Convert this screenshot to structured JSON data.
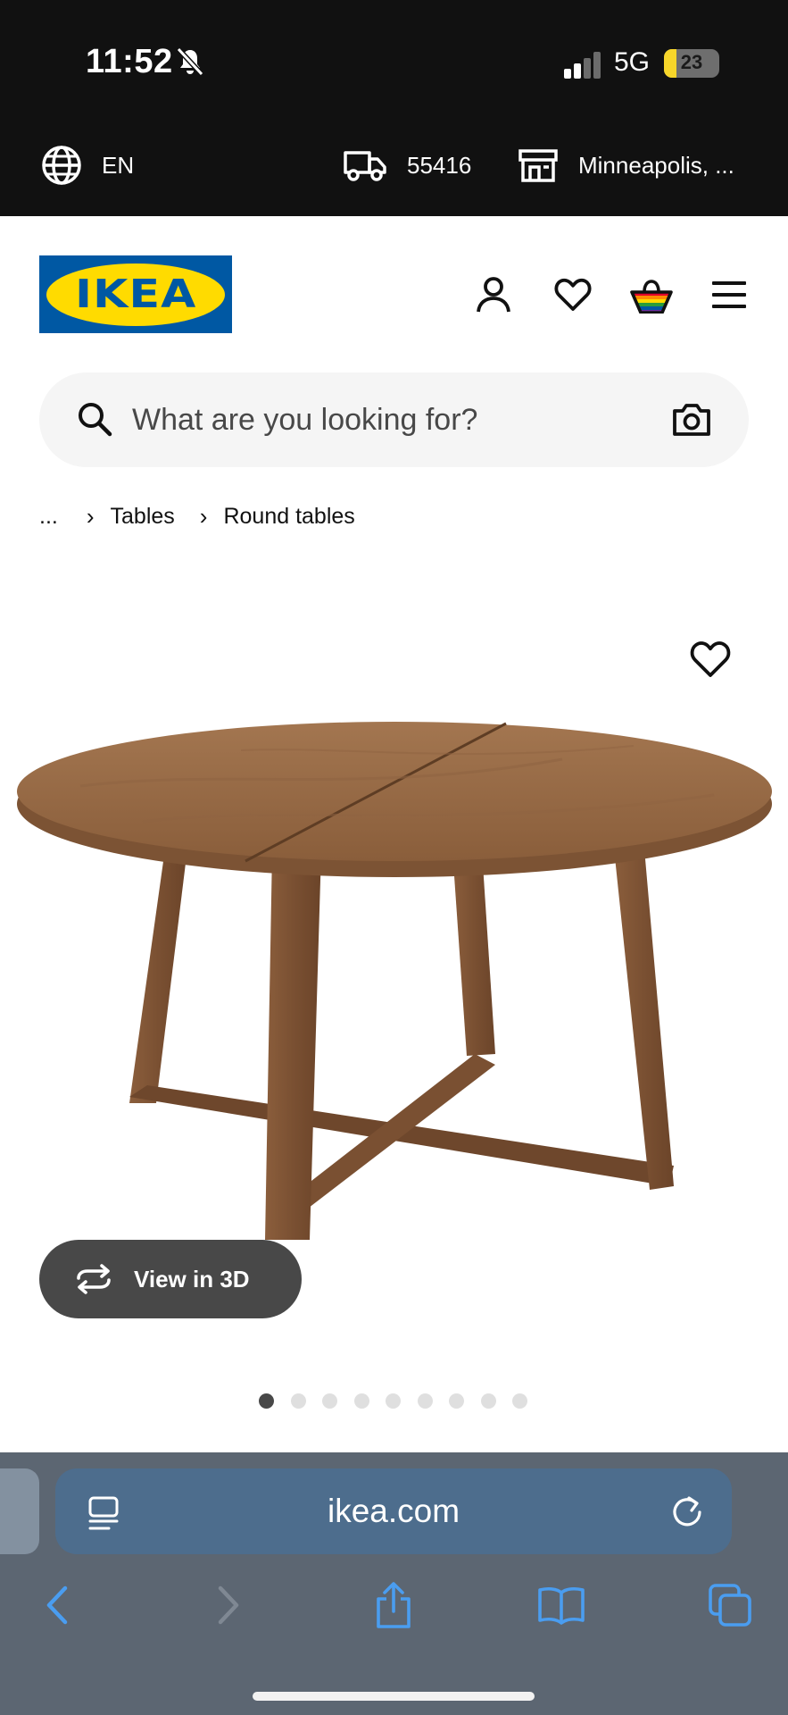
{
  "status_bar": {
    "time": "11:52",
    "network": "5G",
    "battery_level": "23",
    "battery_fraction": 0.23
  },
  "locale_bar": {
    "language": "EN",
    "zip_code": "55416",
    "store": "Minneapolis, ..."
  },
  "header": {
    "logo_text": "IKEA",
    "brand_blue": "#0058a3",
    "brand_yellow": "#ffdb00"
  },
  "search": {
    "placeholder": "What are you looking for?"
  },
  "breadcrumb": {
    "items": [
      "...",
      "Tables",
      "Round tables"
    ]
  },
  "product_media": {
    "view_3d_label": "View in 3D",
    "image_count": 9,
    "active_image": 1
  },
  "browser": {
    "url": "ikea.com",
    "url_bar_color": "#4d6d8d"
  }
}
